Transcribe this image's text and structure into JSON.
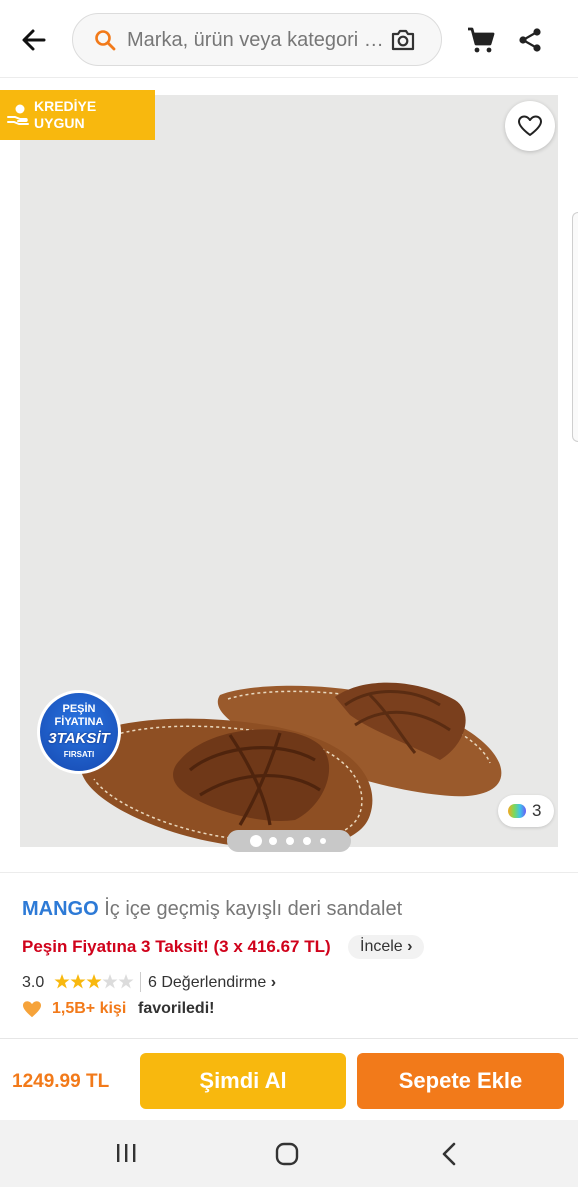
{
  "header": {
    "search_placeholder": "Marka, ürün veya kategori ara",
    "icons": [
      "back-arrow-icon",
      "search-icon",
      "camera-icon",
      "cart-icon",
      "share-icon"
    ]
  },
  "image_area": {
    "credit_badge_line1": "KREDİYE",
    "credit_badge_line2": "UYGUN",
    "taksit_badge": {
      "line1": "PEŞİN",
      "line2": "FİYATINA",
      "line3": "3TAKSİT",
      "line4": "FIRSATI"
    },
    "video_count": "3",
    "pager": {
      "total": 5,
      "active": 1
    }
  },
  "product": {
    "brand": "MANGO",
    "name": "İç içe geçmiş kayışlı deri sandalet",
    "installment_text": "Peşin Fiyatına 3 Taksit! (3 x 416.67 TL)",
    "incele_label": "İncele",
    "rating_score": "3.0",
    "rating_value": 3,
    "rating_max": 5,
    "review_count": "6 Değerlendirme",
    "favorite_count": "1,5B+ kişi",
    "favorite_label": "favoriledi!"
  },
  "action_bar": {
    "price": "1249.99 TL",
    "buy_now_label": "Şimdi Al",
    "add_to_cart_label": "Sepete Ekle"
  },
  "colors": {
    "brand_orange": "#f27a1a",
    "yellow": "#f8b80e",
    "brand_blue": "#2d7ad6",
    "installment_red": "#d0021b"
  }
}
